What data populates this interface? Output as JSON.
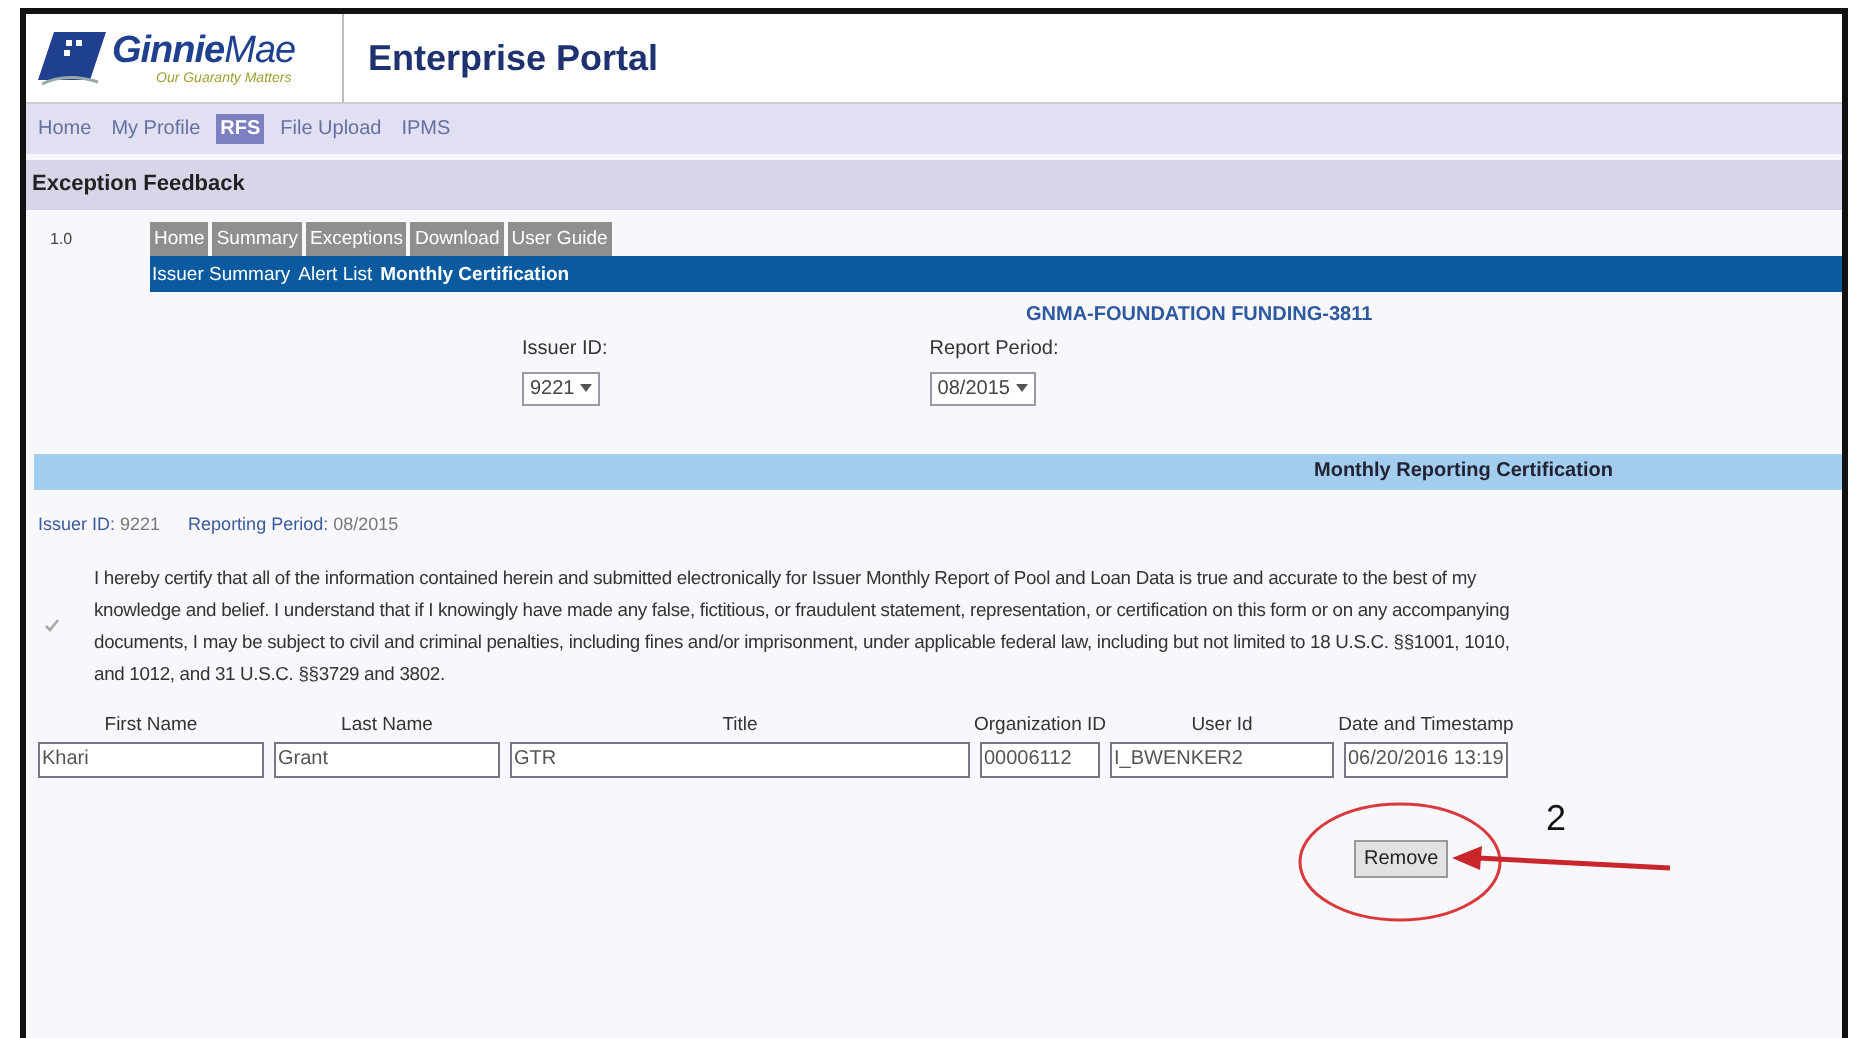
{
  "logo": {
    "wordmark": "**Ginnie**Mae",
    "tagline": "Our Guaranty Matters"
  },
  "portal_title": "Enterprise Portal",
  "nav": [
    {
      "label": "Home",
      "selected": false
    },
    {
      "label": "My Profile",
      "selected": false
    },
    {
      "label": "RFS",
      "selected": true
    },
    {
      "label": "File Upload",
      "selected": false
    },
    {
      "label": "IPMS",
      "selected": false
    }
  ],
  "section_title": "Exception Feedback",
  "version": "1.0",
  "app_tabs": [
    "Home",
    "Summary",
    "Exceptions",
    "Download",
    "User Guide"
  ],
  "subnav": [
    {
      "label": "Issuer Summary",
      "selected": false
    },
    {
      "label": "Alert List",
      "selected": false
    },
    {
      "label": "Monthly Certification",
      "selected": true
    }
  ],
  "issuer_name": "GNMA-FOUNDATION FUNDING-3811",
  "filters": [
    {
      "label": "Issuer ID:",
      "value": "9221"
    },
    {
      "label": "Report Period:",
      "value": "08/2015"
    }
  ],
  "certification": {
    "title": "Monthly Reporting Certification",
    "issuer_id_label": "Issuer ID:",
    "issuer_id": "9221",
    "period_label": "Reporting Period:",
    "period": "08/2015",
    "checked": true,
    "disabled": true,
    "statement": "I hereby certify that all of the information contained herein and submitted electronically for Issuer Monthly Report of Pool and Loan Data is true and accurate to the best of my knowledge and belief. I understand that if I knowingly have made any false, fictitious, or fraudulent statement, representation, or certification on this form or on any accompanying documents, I may be subject to civil and criminal penalties, including fines and/or imprisonment, under applicable federal law, including but not limited to 18 U.S.C. §§1001, 1010, and 1012, and 31 U.S.C. §§3729 and 3802.",
    "fields": [
      {
        "label": "First Name",
        "value": "Khari"
      },
      {
        "label": "Last Name",
        "value": "Grant"
      },
      {
        "label": "Title",
        "value": "GTR"
      },
      {
        "label": "Organization ID",
        "value": "00006112"
      },
      {
        "label": "User Id",
        "value": "I_BWENKER2"
      },
      {
        "label": "Date and Timestamp",
        "value": "06/20/2016 13:19"
      }
    ],
    "remove_button": "Remove"
  },
  "annotation": {
    "number": "2"
  }
}
